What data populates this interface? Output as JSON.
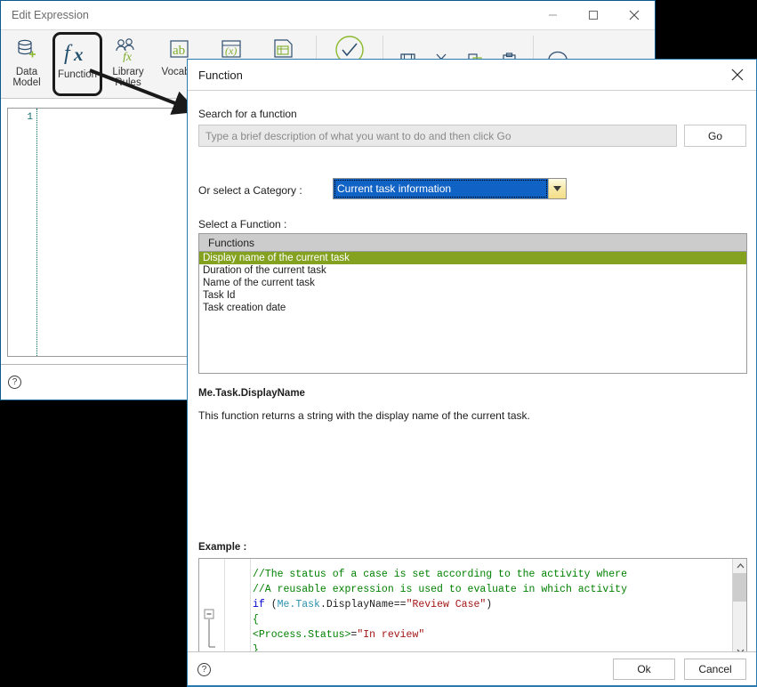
{
  "background_window": {
    "title": "Edit Expression",
    "window_buttons": {
      "minimize": "minimize-icon",
      "maximize": "maximize-icon",
      "close": "close-icon"
    },
    "toolbar": [
      {
        "label_line1": "Data",
        "label_line2": "Model",
        "icon": "database-add-icon",
        "selected": false
      },
      {
        "label_line1": "Function",
        "label_line2": "",
        "icon": "fx-icon",
        "selected": true
      },
      {
        "label_line1": "Library",
        "label_line2": "Rules",
        "icon": "library-rules-icon",
        "selected": false
      },
      {
        "label_line1": "Vocabul",
        "label_line2": "",
        "icon": "vocabulary-ab-icon",
        "selected": false
      },
      {
        "label_line1": "",
        "label_line2": "",
        "icon": "variable-x-icon",
        "selected": false
      },
      {
        "label_line1": "",
        "label_line2": "",
        "icon": "table-icon",
        "selected": false
      },
      {
        "label_line1": "",
        "label_line2": "",
        "icon": "validate-check-icon",
        "selected": false
      }
    ],
    "toolbar_small": [
      {
        "icon": "save-icon"
      },
      {
        "icon": "cut-scissors-icon"
      },
      {
        "icon": "copy-icon"
      },
      {
        "icon": "paste-clipboard-icon"
      },
      {
        "icon": "comment-balloon-icon"
      }
    ],
    "editor": {
      "line_number": "1",
      "content": ""
    },
    "status_help_icon": "help-circle-icon"
  },
  "dialog": {
    "title": "Function",
    "close_icon": "close-icon",
    "search": {
      "label": "Search for a function",
      "placeholder": "Type a brief description of what you want to do and then click Go",
      "value": "",
      "go_label": "Go"
    },
    "category": {
      "label": "Or select a Category :",
      "selected": "Current task information",
      "dropdown_icon": "chevron-down-icon"
    },
    "function_list": {
      "label": "Select a Function :",
      "header": "Functions",
      "items": [
        {
          "text": "Display name of the current task",
          "selected": true
        },
        {
          "text": "Duration of the current task",
          "selected": false
        },
        {
          "text": "Name of the current task",
          "selected": false
        },
        {
          "text": "Task Id",
          "selected": false
        },
        {
          "text": "Task creation date",
          "selected": false
        }
      ]
    },
    "detail": {
      "signature": "Me.Task.DisplayName",
      "description": "This function returns a string with the display name of the current task."
    },
    "example": {
      "label": "Example :",
      "lines": [
        [
          {
            "t": "//The status of a case is set according to the activity where",
            "c": "comment"
          }
        ],
        [
          {
            "t": "//A reusable expression is used to evaluate in which activity",
            "c": "comment"
          }
        ],
        [
          {
            "t": "if ",
            "c": "kw"
          },
          {
            "t": "(",
            "c": "plain"
          },
          {
            "t": "Me.Task",
            "c": "type"
          },
          {
            "t": ".DisplayName==",
            "c": "plain"
          },
          {
            "t": "\"Review Case\"",
            "c": "str"
          },
          {
            "t": ")",
            "c": "plain"
          }
        ],
        [
          {
            "t": "{",
            "c": "green"
          }
        ],
        [
          {
            "t": "<Process.Status>",
            "c": "green"
          },
          {
            "t": "=",
            "c": "plain"
          },
          {
            "t": "\"In review\"",
            "c": "str"
          }
        ],
        [
          {
            "t": "}",
            "c": "green"
          }
        ]
      ],
      "fold_marker": "collapse-minus-icon",
      "scroll_up_icon": "chevron-up-icon",
      "scroll_down_icon": "chevron-down-icon",
      "scroll_left_icon": "chevron-left-icon",
      "scroll_right_icon": "chevron-right-icon"
    },
    "footer": {
      "help_icon": "help-circle-icon",
      "ok_label": "Ok",
      "cancel_label": "Cancel"
    }
  },
  "colors": {
    "accent_blue": "#2a7ab0",
    "selection_green": "#84a220",
    "combo_blue": "#1062c4",
    "comment_green": "#008000",
    "string_red": "#a31515",
    "keyword_blue": "#0000d0",
    "type_teal": "#2b91af"
  }
}
